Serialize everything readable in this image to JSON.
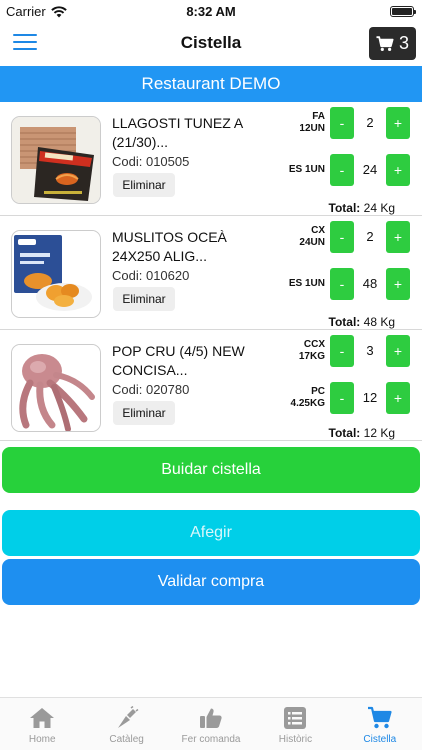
{
  "status_bar": {
    "carrier": "Carrier",
    "time": "8:32 AM"
  },
  "nav": {
    "title": "Cistella",
    "cart_count": "3"
  },
  "restaurant": "Restaurant DEMO",
  "items": [
    {
      "name": "LLAGOSTI TUNEZ A (21/30)...",
      "code": "Codi: 010505",
      "remove_label": "Eliminar",
      "rows": [
        {
          "unit": "FA 12UN",
          "qty": "2"
        },
        {
          "unit": "ES 1UN",
          "qty": "24"
        }
      ],
      "total_label": "Total:",
      "total_value": "24 Kg"
    },
    {
      "name": "MUSLITOS OCEÀ 24X250 ALIG...",
      "code": "Codi: 010620",
      "remove_label": "Eliminar",
      "rows": [
        {
          "unit": "CX 24UN",
          "qty": "2"
        },
        {
          "unit": "ES 1UN",
          "qty": "48"
        }
      ],
      "total_label": "Total:",
      "total_value": "48 Kg"
    },
    {
      "name": "POP CRU (4/5) NEW CONCISA...",
      "code": "Codi: 020780",
      "remove_label": "Eliminar",
      "rows": [
        {
          "unit": "CCX 17KG",
          "qty": "3"
        },
        {
          "unit": "PC 4.25KG",
          "qty": "12"
        }
      ],
      "total_label": "Total:",
      "total_value": "12 Kg"
    }
  ],
  "buttons": {
    "empty": "Buidar cistella",
    "add": "Afegir",
    "validate": "Validar compra",
    "minus": "-",
    "plus": "+"
  },
  "tabs": [
    {
      "label": "Home",
      "icon": "home-icon"
    },
    {
      "label": "Catàleg",
      "icon": "catalog-icon"
    },
    {
      "label": "Fer comanda",
      "icon": "thumbs-up-icon"
    },
    {
      "label": "Històric",
      "icon": "list-icon"
    },
    {
      "label": "Cistella",
      "icon": "cart-icon"
    }
  ],
  "colors": {
    "header_blue": "#2196f3",
    "qty_green": "#2ecc40",
    "empty_green": "#27d13b",
    "add_cyan": "#00cfe8",
    "validate_blue": "#1e8ff0",
    "tab_active": "#1e88e5"
  }
}
